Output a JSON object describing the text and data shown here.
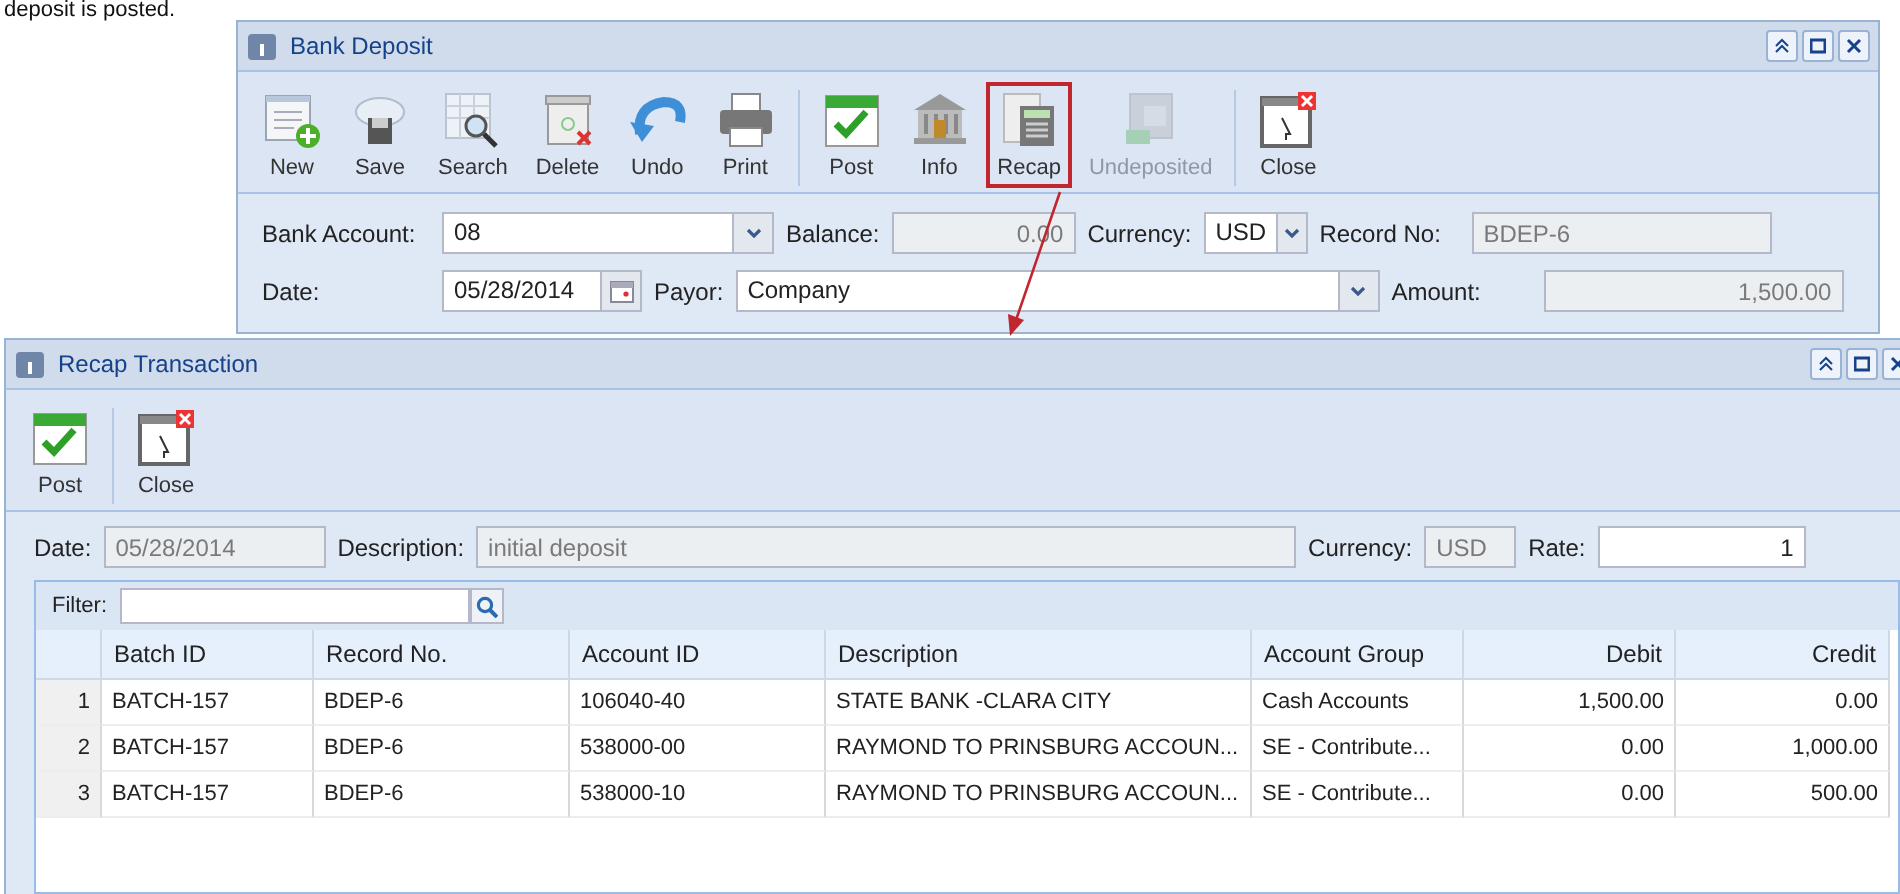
{
  "caption": "deposit is posted.",
  "bank_window": {
    "title": "Bank Deposit",
    "toolbar": [
      {
        "label": "New",
        "kind": "new",
        "disabled": false,
        "highlighted": false,
        "separator_before": false
      },
      {
        "label": "Save",
        "kind": "save",
        "disabled": false,
        "highlighted": false,
        "separator_before": false
      },
      {
        "label": "Search",
        "kind": "search",
        "disabled": false,
        "highlighted": false,
        "separator_before": false
      },
      {
        "label": "Delete",
        "kind": "delete",
        "disabled": false,
        "highlighted": false,
        "separator_before": false
      },
      {
        "label": "Undo",
        "kind": "undo",
        "disabled": false,
        "highlighted": false,
        "separator_before": false
      },
      {
        "label": "Print",
        "kind": "print",
        "disabled": false,
        "highlighted": false,
        "separator_before": false
      },
      {
        "label": "Post",
        "kind": "post",
        "disabled": false,
        "highlighted": false,
        "separator_before": true
      },
      {
        "label": "Info",
        "kind": "info",
        "disabled": false,
        "highlighted": false,
        "separator_before": false
      },
      {
        "label": "Recap",
        "kind": "recap",
        "disabled": false,
        "highlighted": true,
        "separator_before": false
      },
      {
        "label": "Undeposited",
        "kind": "undeposited",
        "disabled": true,
        "highlighted": false,
        "separator_before": false
      },
      {
        "label": "Close",
        "kind": "close",
        "disabled": false,
        "highlighted": false,
        "separator_before": true
      }
    ],
    "field_rows": [
      [
        {
          "label": "Bank Account:",
          "value": "08",
          "kind": "combo"
        },
        {
          "label": "Balance:",
          "value": "0.00",
          "kind": "number",
          "readonly": true
        },
        {
          "label": "Currency:",
          "value": "USD",
          "kind": "combo"
        },
        {
          "label": "Record No:",
          "value": "BDEP-6",
          "kind": "text",
          "readonly": true
        }
      ],
      [
        {
          "label": "Date:",
          "value": "05/28/2014",
          "kind": "date"
        },
        {
          "label": "Payor:",
          "value": "Company",
          "kind": "combo"
        },
        {
          "label": "Amount:",
          "value": "1,500.00",
          "kind": "number",
          "readonly": true
        }
      ]
    ]
  },
  "recap_window": {
    "title": "Recap Transaction",
    "toolbar": [
      {
        "label": "Post",
        "kind": "post",
        "disabled": false,
        "highlighted": false,
        "separator_before": false
      },
      {
        "label": "Close",
        "kind": "close",
        "disabled": false,
        "highlighted": false,
        "separator_before": true
      }
    ],
    "fields": [
      {
        "label": "Date:",
        "value": "05/28/2014",
        "readonly": true,
        "kind": "text"
      },
      {
        "label": "Description:",
        "value": "initial deposit",
        "readonly": true,
        "kind": "text"
      },
      {
        "label": "Currency:",
        "value": "USD",
        "readonly": true,
        "kind": "text"
      },
      {
        "label": "Rate:",
        "value": "1",
        "readonly": false,
        "kind": "number"
      }
    ],
    "filter": {
      "label": "Filter:"
    },
    "table": {
      "columns": [
        {
          "label": "Batch ID",
          "kind": "text"
        },
        {
          "label": "Record No.",
          "kind": "text"
        },
        {
          "label": "Account ID",
          "kind": "text"
        },
        {
          "label": "Description",
          "kind": "text"
        },
        {
          "label": "Account Group",
          "kind": "text"
        },
        {
          "label": "Debit",
          "kind": "number"
        },
        {
          "label": "Credit",
          "kind": "number"
        }
      ],
      "rows": [
        {
          "number": "1",
          "cells": [
            "BATCH-157",
            "BDEP-6",
            "106040-40",
            "STATE BANK -CLARA CITY",
            "Cash Accounts",
            "1,500.00",
            "0.00"
          ]
        },
        {
          "number": "2",
          "cells": [
            "BATCH-157",
            "BDEP-6",
            "538000-00",
            "RAYMOND TO PRINSBURG ACCOUN...",
            "SE - Contribute...",
            "0.00",
            "1,000.00"
          ]
        },
        {
          "number": "3",
          "cells": [
            "BATCH-157",
            "BDEP-6",
            "538000-10",
            "RAYMOND TO PRINSBURG ACCOUN...",
            "SE - Contribute...",
            "0.00",
            "500.00"
          ]
        }
      ]
    }
  }
}
